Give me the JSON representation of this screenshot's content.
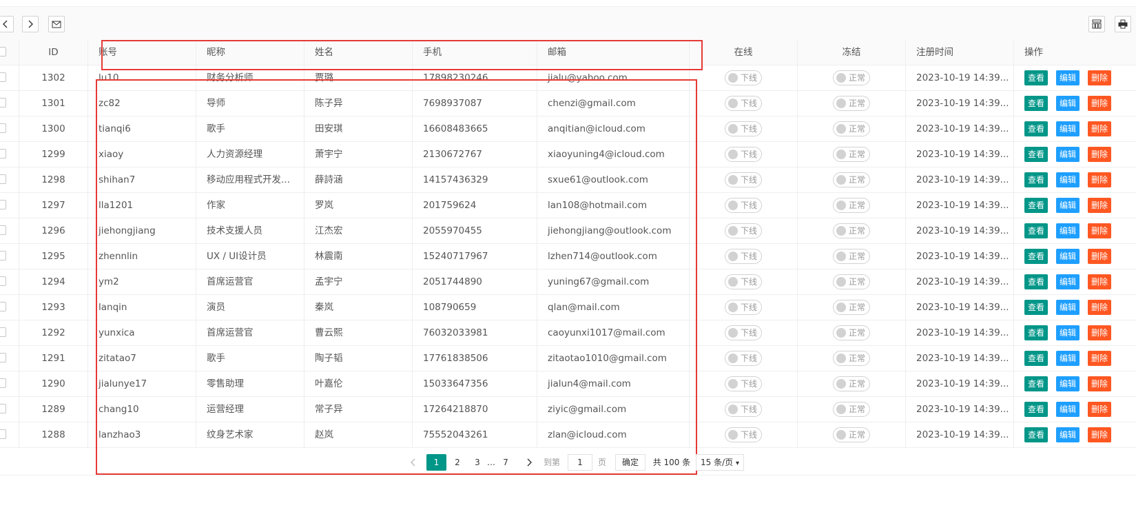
{
  "toolbar": {
    "prev_icon": "chevron-left-icon",
    "next_icon": "chevron-right-icon",
    "mail_icon": "mail-icon",
    "columns_icon": "columns-icon",
    "print_icon": "print-icon"
  },
  "table": {
    "headers": [
      "ID",
      "账号",
      "昵称",
      "姓名",
      "手机",
      "邮箱",
      "在线",
      "冻结",
      "注册时间",
      "操作"
    ],
    "online_label": "下线",
    "frozen_label": "正常",
    "actions": {
      "view": "查看",
      "edit": "编辑",
      "delete": "删除"
    },
    "rows": [
      {
        "id": "1302",
        "account": "lu10",
        "nickname": "财务分析师",
        "name": "贾璐",
        "phone": "17898230246",
        "email": "jialu@yahoo.com",
        "time": "2023-10-19 14:39..."
      },
      {
        "id": "1301",
        "account": "zc82",
        "nickname": "导师",
        "name": "陈子异",
        "phone": "7698937087",
        "email": "chenzi@gmail.com",
        "time": "2023-10-19 14:39..."
      },
      {
        "id": "1300",
        "account": "tianqi6",
        "nickname": "歌手",
        "name": "田安琪",
        "phone": "16608483665",
        "email": "anqitian@icloud.com",
        "time": "2023-10-19 14:39..."
      },
      {
        "id": "1299",
        "account": "xiaoy",
        "nickname": "人力资源经理",
        "name": "萧宇宁",
        "phone": "2130672767",
        "email": "xiaoyuning4@icloud.com",
        "time": "2023-10-19 14:39..."
      },
      {
        "id": "1298",
        "account": "shihan7",
        "nickname": "移动应用程式开发...",
        "name": "薛詩涵",
        "phone": "14157436329",
        "email": "sxue61@outlook.com",
        "time": "2023-10-19 14:39..."
      },
      {
        "id": "1297",
        "account": "lla1201",
        "nickname": "作家",
        "name": "罗岚",
        "phone": "201759624",
        "email": "lan108@hotmail.com",
        "time": "2023-10-19 14:39..."
      },
      {
        "id": "1296",
        "account": "jiehongjiang",
        "nickname": "技术支援人员",
        "name": "江杰宏",
        "phone": "2055970455",
        "email": "jiehongjiang@outlook.com",
        "time": "2023-10-19 14:39..."
      },
      {
        "id": "1295",
        "account": "zhennlin",
        "nickname": "UX / UI设计员",
        "name": "林震南",
        "phone": "15240717967",
        "email": "lzhen714@outlook.com",
        "time": "2023-10-19 14:39..."
      },
      {
        "id": "1294",
        "account": "ym2",
        "nickname": "首席运营官",
        "name": "孟宇宁",
        "phone": "2051744890",
        "email": "yuning67@gmail.com",
        "time": "2023-10-19 14:39..."
      },
      {
        "id": "1293",
        "account": "lanqin",
        "nickname": "演员",
        "name": "秦岚",
        "phone": "108790659",
        "email": "qlan@mail.com",
        "time": "2023-10-19 14:39..."
      },
      {
        "id": "1292",
        "account": "yunxica",
        "nickname": "首席运营官",
        "name": "曹云熙",
        "phone": "76032033981",
        "email": "caoyunxi1017@mail.com",
        "time": "2023-10-19 14:39..."
      },
      {
        "id": "1291",
        "account": "zitatao7",
        "nickname": "歌手",
        "name": "陶子韬",
        "phone": "17761838506",
        "email": "zitaotao1010@gmail.com",
        "time": "2023-10-19 14:39..."
      },
      {
        "id": "1290",
        "account": "jialunye17",
        "nickname": "零售助理",
        "name": "叶嘉伦",
        "phone": "15033647356",
        "email": "jialun4@mail.com",
        "time": "2023-10-19 14:39..."
      },
      {
        "id": "1289",
        "account": "chang10",
        "nickname": "运营经理",
        "name": "常子异",
        "phone": "17264218870",
        "email": "ziyic@gmail.com",
        "time": "2023-10-19 14:39..."
      },
      {
        "id": "1288",
        "account": "lanzhao3",
        "nickname": "纹身艺术家",
        "name": "赵岚",
        "phone": "75552043261",
        "email": "zlan@icloud.com",
        "time": "2023-10-19 14:39..."
      }
    ]
  },
  "pagination": {
    "pages": [
      "1",
      "2",
      "3",
      "…",
      "7"
    ],
    "current": "1",
    "goto_label": "到第",
    "goto_value": "1",
    "page_unit": "页",
    "confirm": "确定",
    "total": "共 100 条",
    "page_size": "15 条/页"
  },
  "colors": {
    "view": "#009688",
    "edit": "#1e9fff",
    "delete": "#ff5722",
    "highlight": "#e53935"
  }
}
